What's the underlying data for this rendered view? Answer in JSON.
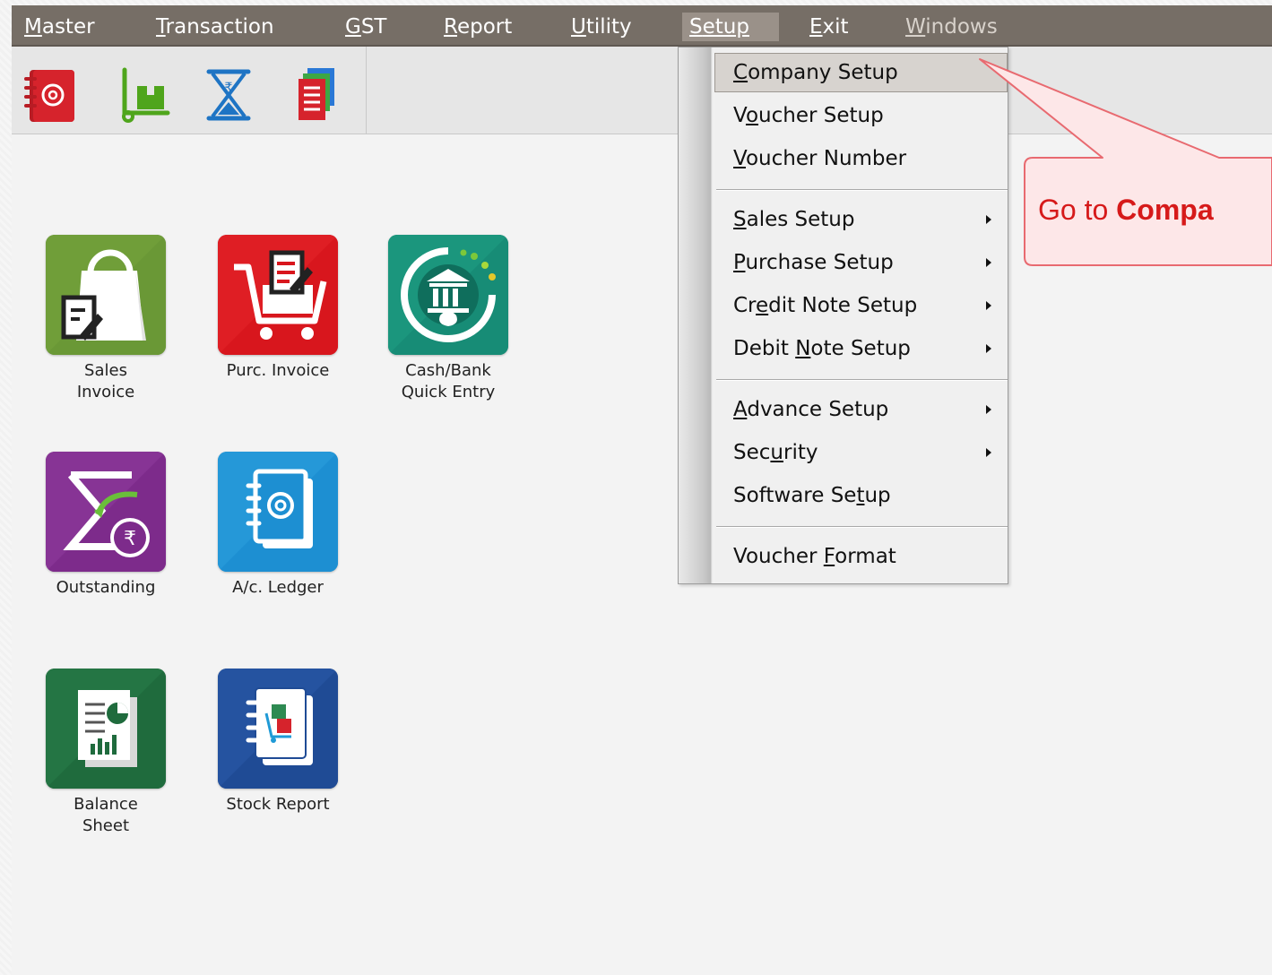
{
  "menubar": {
    "items": [
      {
        "pre": "",
        "key": "M",
        "post": "aster"
      },
      {
        "pre": "",
        "key": "T",
        "post": "ransaction"
      },
      {
        "pre": "",
        "key": "G",
        "post": "ST"
      },
      {
        "pre": "",
        "key": "R",
        "post": "eport"
      },
      {
        "pre": "",
        "key": "U",
        "post": "tility"
      },
      {
        "pre": "",
        "key": "S",
        "post": "etup"
      },
      {
        "pre": "",
        "key": "E",
        "post": "xit"
      },
      {
        "pre": "",
        "key": "W",
        "post": "indows"
      }
    ]
  },
  "toolbar": {
    "icons": [
      "address-book-icon",
      "trolley-icon",
      "hourglass-rupee-icon",
      "documents-icon"
    ]
  },
  "tiles": [
    {
      "label": "Sales\nInvoice",
      "icon": "shopping-bag-icon",
      "color": "#5e8a2e"
    },
    {
      "label": "Purc. Invoice",
      "icon": "cart-icon",
      "color": "#d4161d"
    },
    {
      "label": "Cash/Bank\nQuick Entry",
      "icon": "bank-icon",
      "color": "#168a74"
    },
    {
      "label": "Outstanding",
      "icon": "sigma-rupee-icon",
      "color": "#7a2a88"
    },
    {
      "label": "A/c. Ledger",
      "icon": "address-book-icon",
      "color": "#1e8ed0"
    },
    {
      "label": "Balance\nSheet",
      "icon": "report-chart-icon",
      "color": "#1f6a3c"
    },
    {
      "label": "Stock Report",
      "icon": "stock-book-icon",
      "color": "#1f4a93"
    }
  ],
  "dropdown": {
    "items": [
      {
        "pre": "",
        "key": "C",
        "post": "ompany Setup",
        "submenu": false
      },
      {
        "pre": "V",
        "key": "o",
        "post": "ucher Setup",
        "submenu": false
      },
      {
        "pre": "",
        "key": "V",
        "post": "oucher Number",
        "submenu": false
      },
      {
        "pre": "",
        "key": "S",
        "post": "ales Setup",
        "submenu": true
      },
      {
        "pre": "",
        "key": "P",
        "post": "urchase Setup",
        "submenu": true
      },
      {
        "pre": "Cr",
        "key": "e",
        "post": "dit Note Setup",
        "submenu": true
      },
      {
        "pre": "Debit ",
        "key": "N",
        "post": "ote Setup",
        "submenu": true
      },
      {
        "pre": "",
        "key": "A",
        "post": "dvance Setup",
        "submenu": true
      },
      {
        "pre": "Sec",
        "key": "u",
        "post": "rity",
        "submenu": true
      },
      {
        "pre": "Software Se",
        "key": "t",
        "post": "up",
        "submenu": false
      },
      {
        "pre": "Voucher ",
        "key": "F",
        "post": "ormat",
        "submenu": false
      }
    ]
  },
  "callout": {
    "prefix": "Go to ",
    "bold": "Compa"
  },
  "colors": {
    "menubar": "#766e66",
    "callout_fill": "#fde7e8",
    "callout_border": "#e86a70",
    "callout_text": "#d61a1a"
  }
}
